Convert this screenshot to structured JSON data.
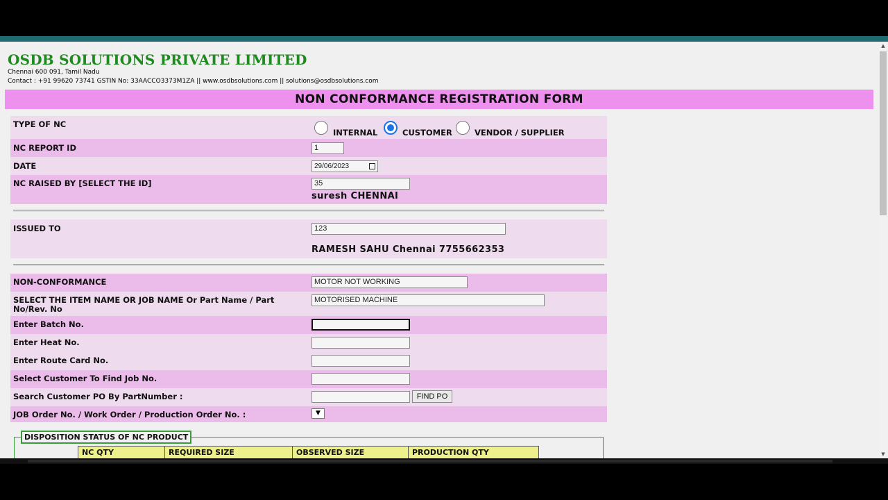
{
  "company": {
    "name": "OSDB SOLUTIONS PRIVATE LIMITED",
    "address": "Chennai 600 091, Tamil Nadu",
    "contact": "Contact : +91 99620 73741 GSTIN No: 33AACCO3373M1ZA || www.osdbsolutions.com || solutions@osdbsolutions.com"
  },
  "form": {
    "title": "NON CONFORMANCE REGISTRATION FORM",
    "type_of_nc": {
      "label": "TYPE OF NC",
      "options": [
        "INTERNAL",
        "CUSTOMER",
        "VENDOR / SUPPLIER"
      ],
      "selected": "CUSTOMER"
    },
    "report_id": {
      "label": "NC REPORT ID",
      "value": "1"
    },
    "date": {
      "label": "DATE",
      "value": "29/06/2023"
    },
    "raised_by": {
      "label": "NC RAISED BY [SELECT THE ID]",
      "value": "35",
      "name": "suresh CHENNAI"
    },
    "issued_to": {
      "label": "ISSUED TO",
      "value": "123",
      "name": "RAMESH SAHU Chennai 7755662353"
    },
    "non_conformance": {
      "label": "NON-CONFORMANCE",
      "value": "MOTOR NOT WORKING"
    },
    "item_name": {
      "label_line1": "SELECT THE ITEM NAME OR JOB NAME Or Part Name / Part",
      "label_line2": "No/Rev. No",
      "value": "MOTORISED MACHINE"
    },
    "batch_no": {
      "label": "Enter Batch No.",
      "value": ""
    },
    "heat_no": {
      "label": "Enter Heat No.",
      "value": ""
    },
    "route_card": {
      "label": "Enter Route Card No.",
      "value": ""
    },
    "customer_job": {
      "label": "Select Customer To Find Job No.",
      "value": ""
    },
    "customer_po": {
      "label": "Search Customer PO By PartNumber :",
      "value": "",
      "button": "FIND PO"
    },
    "job_order": {
      "label": "JOB Order No. / Work Order / Production Order No. :",
      "value": ""
    },
    "disposition": {
      "legend": "DISPOSITION STATUS OF NC PRODUCT",
      "columns": [
        "NC QTY",
        "REQUIRED SIZE",
        "OBSERVED SIZE",
        "PRODUCTION QTY"
      ]
    }
  },
  "colors": {
    "title_bar": "#ee90ee",
    "row_dark": "#ebbce9",
    "row_light": "#efdbee",
    "company": "#1f8a1f",
    "radio_selected": "#1a73e8",
    "table_header": "#eef08c"
  }
}
